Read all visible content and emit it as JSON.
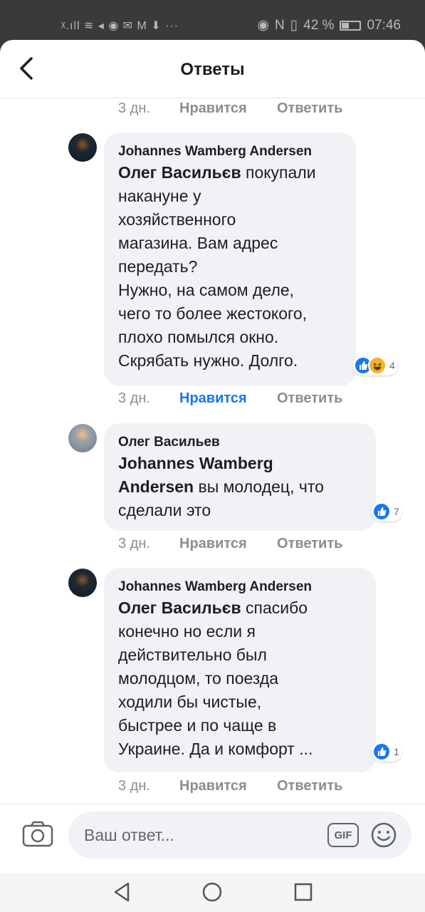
{
  "status_bar": {
    "left_icons": "ᵡ.ıll ≋ ◂ ◉ ✉ M ⬇ ···",
    "nfc": "N",
    "battery_pct": "42 %",
    "time": "07:46"
  },
  "header": {
    "title": "Ответы",
    "back_icon": "chevron-left-icon"
  },
  "top_actions": {
    "time": "3 дн.",
    "like": "Нравится",
    "reply": "Ответить"
  },
  "comments": [
    {
      "author": "Johannes Wamberg Andersen",
      "mention": "Олег Васильєв",
      "text_lines": [
        " покупали",
        "накануне у",
        "хозяйственного",
        "магазина. Вам адрес",
        "передать?",
        "Нужно, на самом деле,",
        "чего то более жестокого,",
        "плохо помылся окно.",
        "Скрябать нужно. Долго."
      ],
      "reactions": [
        "like",
        "haha"
      ],
      "reaction_count": "4",
      "time": "3 дн.",
      "like": "Нравится",
      "reply": "Ответить",
      "liked": true
    },
    {
      "author": "Олег Васильев",
      "mention_lines": [
        "Johannes Wamberg",
        "Andersen"
      ],
      "text_lines": [
        " вы молодец, что",
        "сделали это"
      ],
      "reactions": [
        "like"
      ],
      "reaction_count": "7",
      "time": "3 дн.",
      "like": "Нравится",
      "reply": "Ответить",
      "liked": false
    },
    {
      "author": "Johannes Wamberg Andersen",
      "mention": "Олег Васильєв",
      "text_lines": [
        " спасибо",
        "конечно но если я",
        "действительно был",
        "молодцом, то поезда",
        "ходили бы чистые,",
        "быстрее и по чаще в",
        "Украине. Да и комфорт ..."
      ],
      "reactions": [
        "like"
      ],
      "reaction_count": "1",
      "time": "3 дн.",
      "like": "Нравится",
      "reply": "Ответить",
      "liked": false
    }
  ],
  "composer": {
    "placeholder": "Ваш ответ...",
    "gif_label": "GIF",
    "camera_icon": "camera-icon",
    "emoji_icon": "emoji-icon"
  },
  "colors": {
    "link_blue": "#1877f2",
    "bubble_bg": "#f0f2f5",
    "muted": "#8a8d91"
  }
}
